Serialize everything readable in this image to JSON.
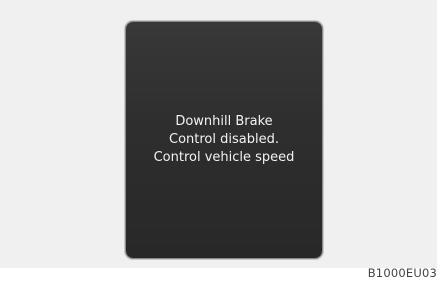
{
  "display": {
    "message_lines": [
      "Downhill Brake",
      "Control disabled.",
      "Control vehicle speed"
    ]
  },
  "figure_code": "B1000EU03",
  "colors": {
    "background": "#f0f0f0",
    "screen": "#2e2e2e",
    "text": "#f2f2f2"
  }
}
